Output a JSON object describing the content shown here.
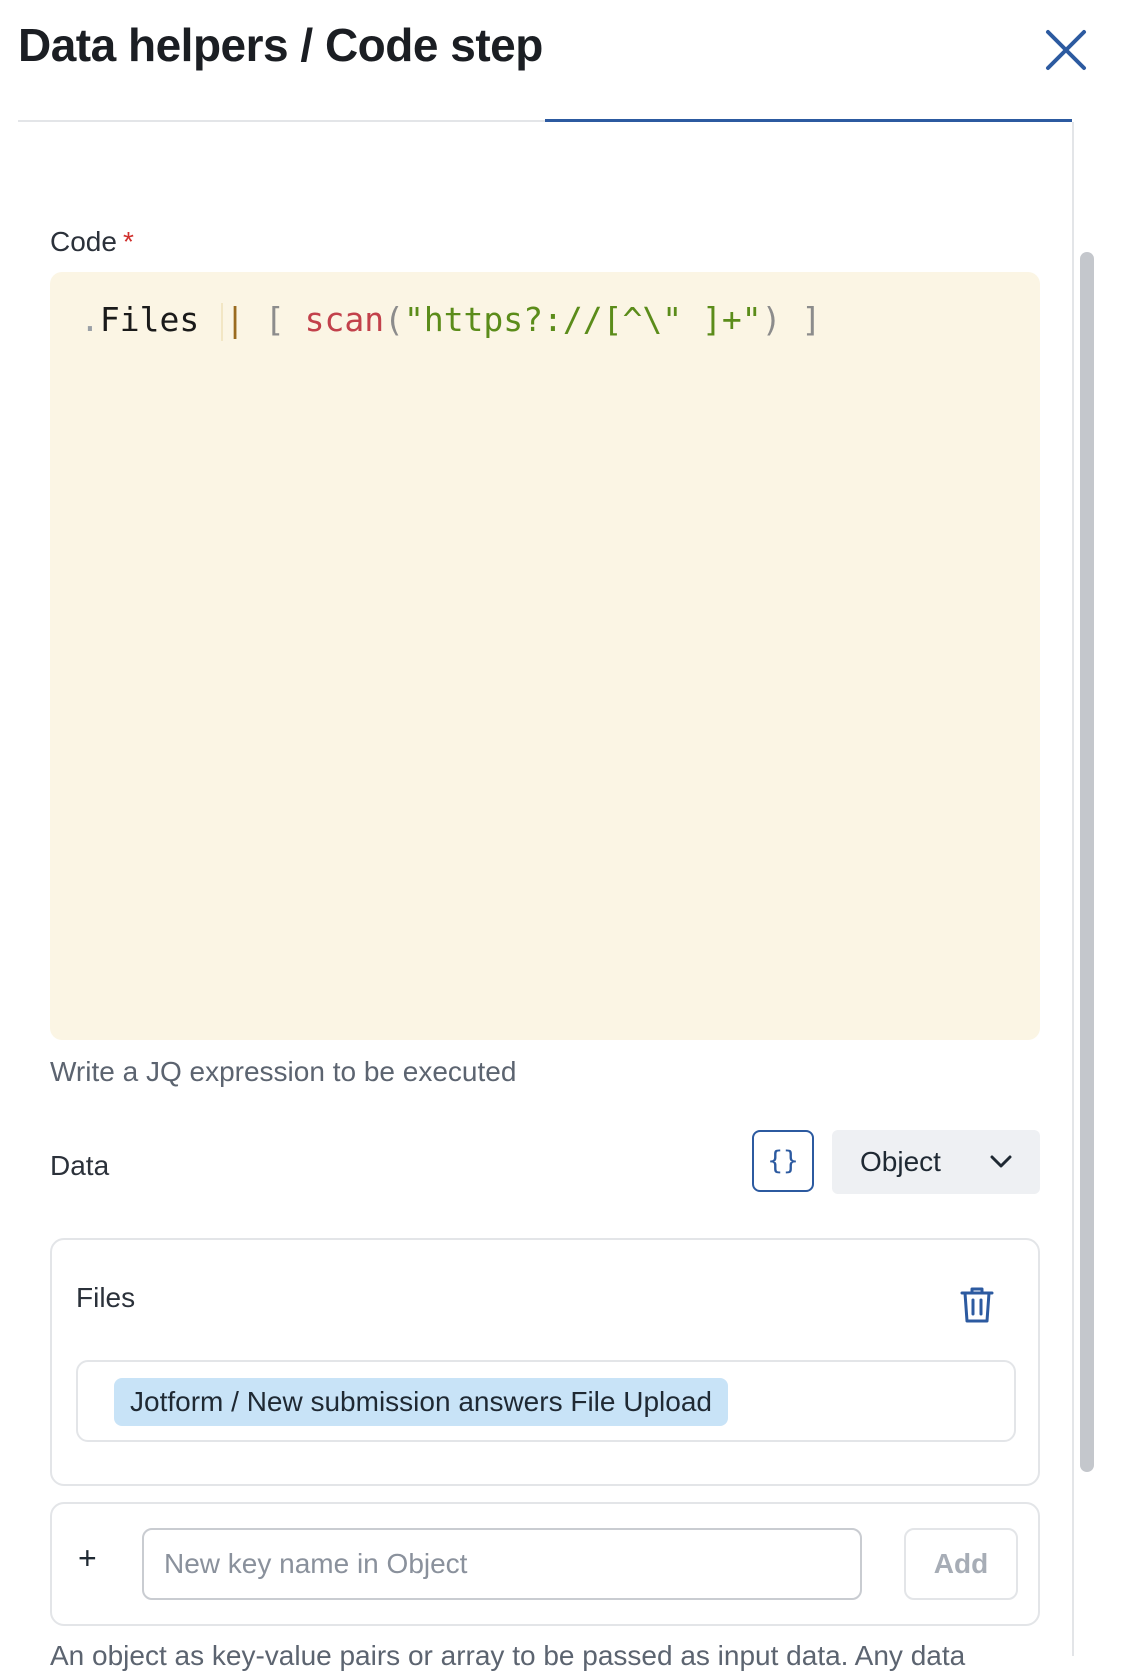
{
  "header": {
    "title": "Data helpers / Code step",
    "close_icon": "close-icon"
  },
  "code_field": {
    "label": "Code",
    "required_mark": "*",
    "tokens": {
      "dot": ".",
      "identifier": "Files",
      "pipe": "|",
      "open_bracket": "[",
      "function": "scan",
      "open_paren": "(",
      "string": "\"https?://[^\\\" ]+\"",
      "close_paren": ")",
      "close_bracket": "]"
    },
    "helper": "Write a JQ expression to be executed",
    "background_color": "#fbf5e4"
  },
  "data_field": {
    "label": "Data",
    "json_toggle_glyph": "{}",
    "type_select": {
      "value": "Object",
      "icon": "chevron-down-icon"
    },
    "entries": [
      {
        "key": "Files",
        "value_token": "Jotform / New submission answers File Upload",
        "delete_icon": "trash-icon"
      }
    ],
    "new_key": {
      "add_icon": "plus-icon",
      "placeholder": "New key name in Object",
      "add_label": "Add"
    },
    "description": "An object as key-value pairs or array to be passed as input data. Any data"
  },
  "colors": {
    "accent": "#2c5aa0",
    "token_pill": "#c8e3f7",
    "required": "#d0302d"
  }
}
